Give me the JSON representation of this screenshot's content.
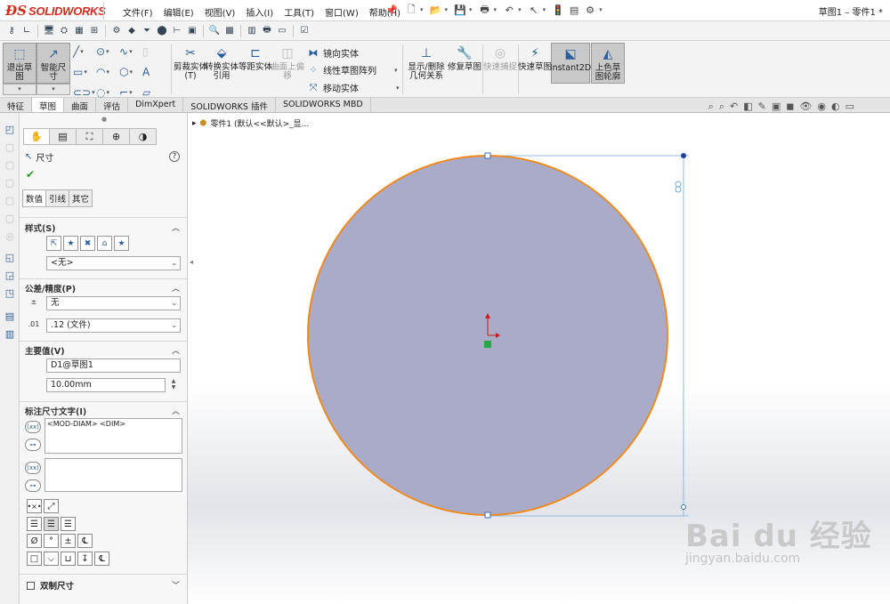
{
  "app": {
    "logo_text": "SOLIDWORKS",
    "window_title": "草图1 – 零件1 *"
  },
  "menu": [
    "文件(F)",
    "编辑(E)",
    "视图(V)",
    "插入(I)",
    "工具(T)",
    "窗口(W)",
    "帮助(H)"
  ],
  "command_manager": {
    "exit_sketch": "退出草图",
    "smart_dimension": "智能尺寸",
    "trim": "剪裁实体(T)",
    "convert": "转换实体引用",
    "offset": "等距实体",
    "surface_offset": "曲面上偏移",
    "mirror": "镜向实体",
    "linear_pattern": "线性草图阵列",
    "move": "移动实体",
    "display_delete": "显示/删除几何关系",
    "repair": "修复草图",
    "quick_snap": "快速捕捉",
    "rapid_sketch": "快速草图",
    "instant2d": "Instant2D",
    "shaded_contours": "上色草图轮廓"
  },
  "tabs": [
    "特征",
    "草图",
    "曲面",
    "评估",
    "DimXpert",
    "SOLIDWORKS 插件",
    "SOLIDWORKS MBD"
  ],
  "property_manager": {
    "title": "尺寸",
    "sub_tabs": [
      "数值",
      "引线",
      "其它"
    ],
    "style_section": "样式(S)",
    "style_value": "<无>",
    "tolerance_section": "公差/精度(P)",
    "tolerance_type": "无",
    "precision_value": ".12 (文件)",
    "primary_section": "主要值(V)",
    "primary_name": "D1@草图1",
    "primary_value": "10.00mm",
    "dim_text_section": "标注尺寸文字(I)",
    "dim_text_value": "<MOD-DIAM> <DIM>",
    "dual_dimension": "双制尺寸"
  },
  "feature_tree": {
    "label": "零件1 (默认<<默认>_显..."
  },
  "watermark": {
    "main": "Bai du 经验",
    "sub": "jingyan.baidu.com"
  },
  "colors": {
    "circle_fill": "#a9abc9",
    "circle_stroke": "#f08a1c",
    "dimension_line": "#6fa8dc",
    "accent_red": "#d52b1e"
  }
}
